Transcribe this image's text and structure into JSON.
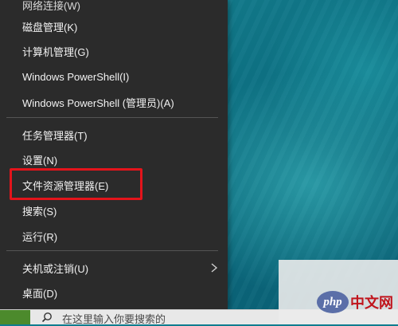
{
  "menu": {
    "partial_item": "网络连接(W)",
    "group1": [
      "磁盘管理(K)",
      "计算机管理(G)",
      "Windows PowerShell(I)",
      "Windows PowerShell (管理员)(A)"
    ],
    "group2": [
      "任务管理器(T)",
      "设置(N)",
      "文件资源管理器(E)",
      "搜索(S)",
      "运行(R)"
    ],
    "group3": [
      "关机或注销(U)",
      "桌面(D)"
    ]
  },
  "taskbar": {
    "search_text": "在这里输入你要搜索的"
  },
  "watermark": {
    "logo_text": "php",
    "site_text": "中文网"
  },
  "colors": {
    "menu_bg": "#2b2b2b",
    "highlight_border": "#e3141b",
    "desktop": "#0f7d8f"
  }
}
